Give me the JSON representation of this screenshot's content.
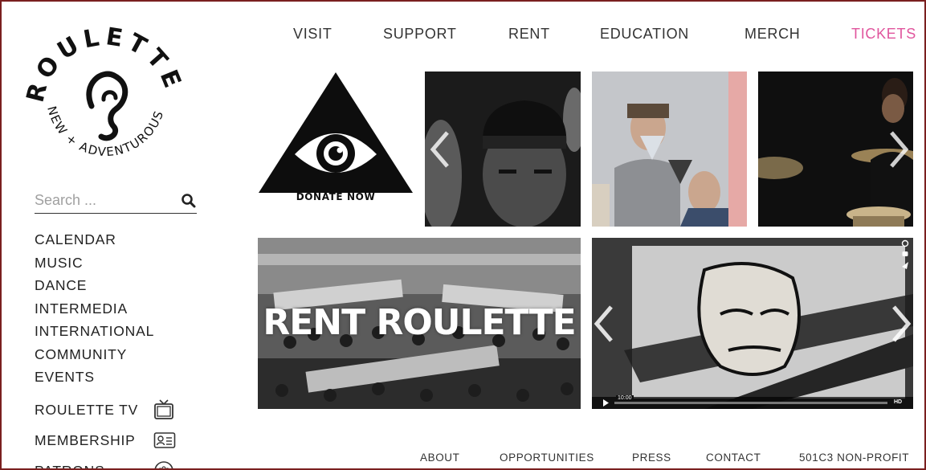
{
  "logo": {
    "wordmark": "ROULETTE",
    "tagline": "NEW + ADVENTUROUS"
  },
  "search": {
    "placeholder": "Search ...",
    "icon": "search-icon"
  },
  "sidebar": {
    "items": [
      {
        "label": "CALENDAR"
      },
      {
        "label": "MUSIC"
      },
      {
        "label": "DANCE"
      },
      {
        "label": "INTERMEDIA"
      },
      {
        "label": "INTERNATIONAL"
      },
      {
        "label": "COMMUNITY"
      },
      {
        "label": "EVENTS"
      }
    ],
    "extras": [
      {
        "label": "ROULETTE TV",
        "icon": "tv-icon"
      },
      {
        "label": "MEMBERSHIP",
        "icon": "member-card-icon"
      },
      {
        "label": "PATRONS",
        "icon": "patrons-icon"
      }
    ]
  },
  "topnav": {
    "visit": "VISIT",
    "support": "SUPPORT",
    "rent": "RENT",
    "education": "EDUCATION",
    "merch": "MERCH",
    "tickets": "TICKETS"
  },
  "tiles": {
    "donate_label": "DONATE NOW",
    "rent_banner": "RENT ROULETTE",
    "video_time": "10:00",
    "video_hd": "HD"
  },
  "footer": {
    "about": "ABOUT",
    "opportunities": "OPPORTUNITIES",
    "press": "PRESS",
    "contact": "CONTACT",
    "nonprofit": "501C3 NON-PROFIT"
  },
  "colors": {
    "frame": "#7a1f1f",
    "tickets": "#e0559d",
    "text": "#222222"
  }
}
